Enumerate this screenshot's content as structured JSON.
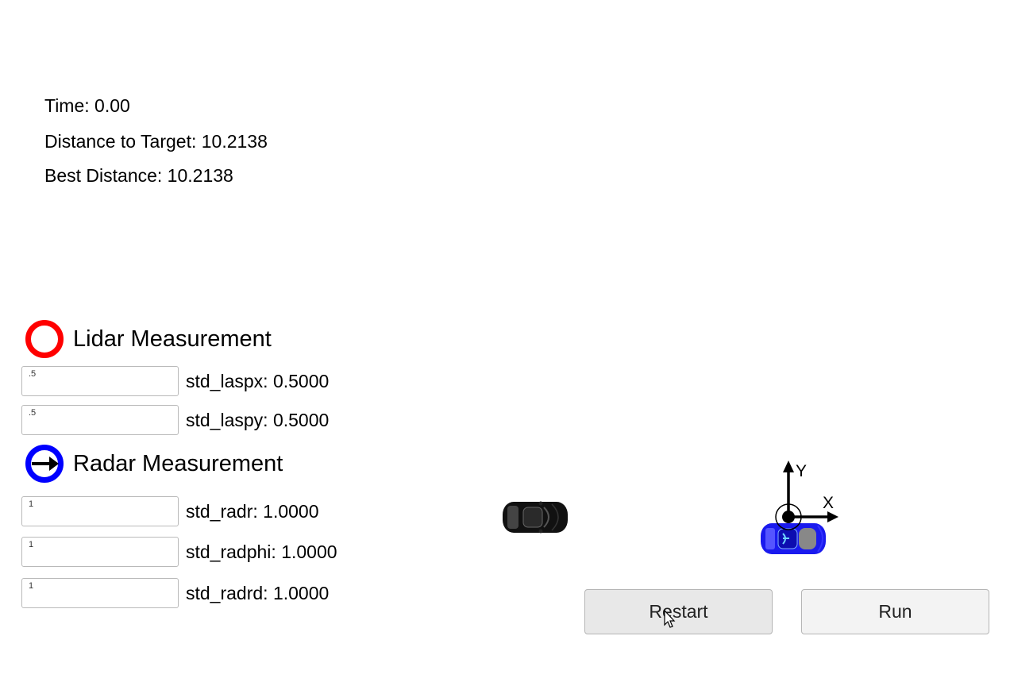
{
  "stats": {
    "time": "Time: 0.00",
    "distance_to_target": "Distance to Target: 10.2138",
    "best_distance": "Best Distance: 10.2138"
  },
  "lidar": {
    "title": "Lidar Measurement",
    "icon": "red-ring-icon",
    "color": "#ff0000",
    "fields": [
      {
        "value": ".5",
        "label": "std_laspx: 0.5000"
      },
      {
        "value": ".5",
        "label": "std_laspy: 0.5000"
      }
    ]
  },
  "radar": {
    "title": "Radar Measurement",
    "icon": "blue-ring-arrow-icon",
    "color": "#0000ff",
    "fields": [
      {
        "value": "1",
        "label": "std_radr: 1.0000"
      },
      {
        "value": "1",
        "label": "std_radphi: 1.0000"
      },
      {
        "value": "1",
        "label": "std_radrd: 1.0000"
      }
    ]
  },
  "axes": {
    "x_label": "X",
    "y_label": "Y"
  },
  "buttons": {
    "restart": "Restart",
    "run": "Run"
  },
  "cars": {
    "target_color": "#111111",
    "ego_color": "#1a1aee"
  }
}
